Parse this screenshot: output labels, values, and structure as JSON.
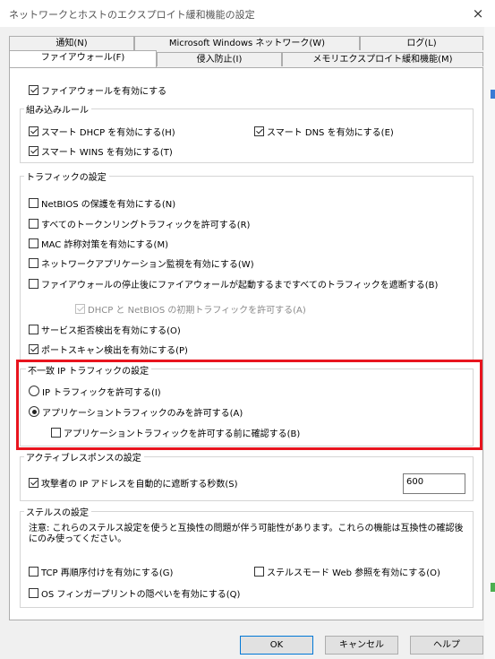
{
  "window": {
    "title": "ネットワークとホストのエクスプロイト緩和機能の設定",
    "close_icon": "×"
  },
  "tabs_row1": [
    "通知(N)",
    "Microsoft Windows ネットワーク(W)",
    "ログ(L)"
  ],
  "tabs_row2": [
    "ファイアウォール(F)",
    "侵入防止(I)",
    "メモリエクスプロイト緩和機能(M)"
  ],
  "firewall": {
    "enable": {
      "label": "ファイアウォールを有効にする",
      "checked": true
    }
  },
  "builtin_rules": {
    "title": "組み込みルール",
    "dhcp": {
      "label": "スマート DHCP を有効にする(H)",
      "checked": true
    },
    "dns": {
      "label": "スマート DNS を有効にする(E)",
      "checked": true
    },
    "wins": {
      "label": "スマート WINS を有効にする(T)",
      "checked": true
    }
  },
  "traffic": {
    "title": "トラフィックの設定",
    "netbios": {
      "label": "NetBIOS の保護を有効にする(N)",
      "checked": false
    },
    "token_ring": {
      "label": "すべてのトークンリングトラフィックを許可する(R)",
      "checked": false
    },
    "mac": {
      "label": "MAC 詐称対策を有効にする(M)",
      "checked": false
    },
    "app_monitor": {
      "label": "ネットワークアプリケーション監視を有効にする(W)",
      "checked": false
    },
    "block_until_start": {
      "label": "ファイアウォールの停止後にファイアウォールが起動するまですべてのトラフィックを遮断する(B)",
      "checked": false
    },
    "dhcp_netbios": {
      "label": "DHCP と NetBIOS の初期トラフィックを許可する(A)",
      "checked": true
    },
    "dos": {
      "label": "サービス拒否検出を有効にする(O)",
      "checked": false
    },
    "portscan": {
      "label": "ポートスキャン検出を有効にする(P)",
      "checked": true
    }
  },
  "mismatch_ip": {
    "title": "不一致 IP トラフィックの設定",
    "allow_ip": {
      "label": "IP トラフィックを許可する(I)",
      "selected": false
    },
    "allow_app_only": {
      "label": "アプリケーショントラフィックのみを許可する(A)",
      "selected": true
    },
    "confirm_before": {
      "label": "アプリケーショントラフィックを許可する前に確認する(B)",
      "checked": false
    }
  },
  "active_response": {
    "title": "アクティブレスポンスの設定",
    "block_seconds": {
      "label": "攻撃者の IP アドレスを自動的に遮断する秒数(S)",
      "checked": true,
      "value": "600"
    }
  },
  "stealth": {
    "title": "ステルスの設定",
    "note": "注意: これらのステルス設定を使うと互換性の問題が伴う可能性があります。これらの機能は互換性の確認後にのみ使ってください。",
    "tcp_reseq": {
      "label": "TCP 再順序付けを有効にする(G)",
      "checked": false
    },
    "stealth_web": {
      "label": "ステルスモード Web 参照を有効にする(O)",
      "checked": false
    },
    "os_fp": {
      "label": "OS フィンガープリントの隠ぺいを有効にする(Q)",
      "checked": false
    }
  },
  "buttons": {
    "ok": "OK",
    "cancel": "キャンセル",
    "help": "ヘルプ"
  },
  "colors": {
    "highlight": "#e8141e",
    "dialog_bg": "#f0f0f0",
    "default_button_border": "#0078d7"
  }
}
